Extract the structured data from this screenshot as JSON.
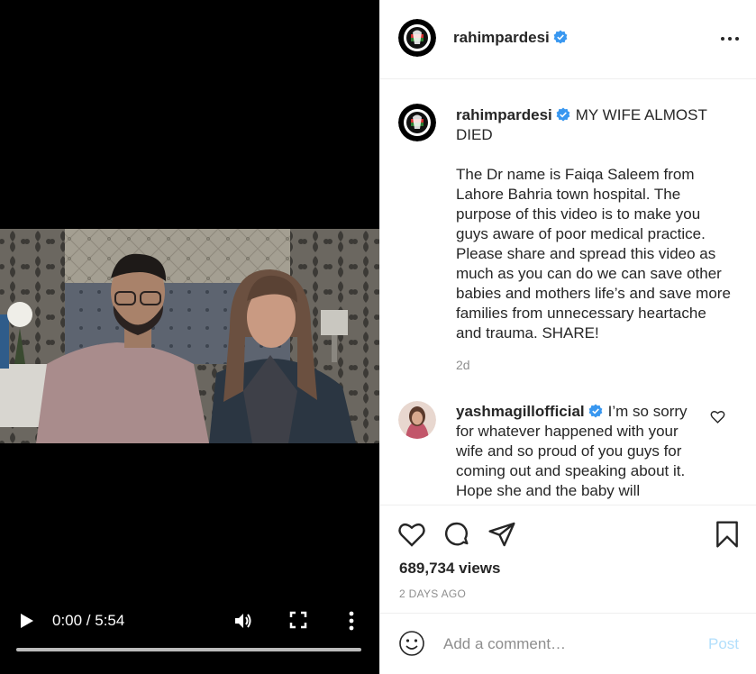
{
  "video": {
    "time_display": "0:00 / 5:54",
    "progress": 0.0
  },
  "header": {
    "username": "rahimpardesi"
  },
  "caption": {
    "username": "rahimpardesi",
    "title": "MY WIFE ALMOST DIED",
    "body": "The Dr name is Faiqa Saleem from Lahore Bahria town hospital. The purpose of this video is to make you guys aware of poor medical practice. Please share and spread this video as much as you can do we can save other babies and mothers life’s and save more families from unnecessary heartache and trauma. SHARE!",
    "age": "2d"
  },
  "comments": [
    {
      "username": "yashmagillofficial",
      "text": "I’m so sorry for whatever happened with your wife and so proud of you guys for coming out and speaking about it. Hope she and the baby will"
    }
  ],
  "stats": {
    "views": "689,734 views",
    "date": "2 DAYS AGO"
  },
  "add_comment": {
    "placeholder": "Add a comment…",
    "post_label": "Post"
  },
  "colors": {
    "verified": "#3897f0",
    "post_disabled": "#b2dffc",
    "muted": "#8e8e8e"
  },
  "icons": [
    "play-icon",
    "volume-icon",
    "fullscreen-icon",
    "more-vertical-icon",
    "verified-icon",
    "more-horizontal-icon",
    "heart-icon",
    "comment-icon",
    "share-icon",
    "bookmark-icon",
    "emoji-icon"
  ]
}
